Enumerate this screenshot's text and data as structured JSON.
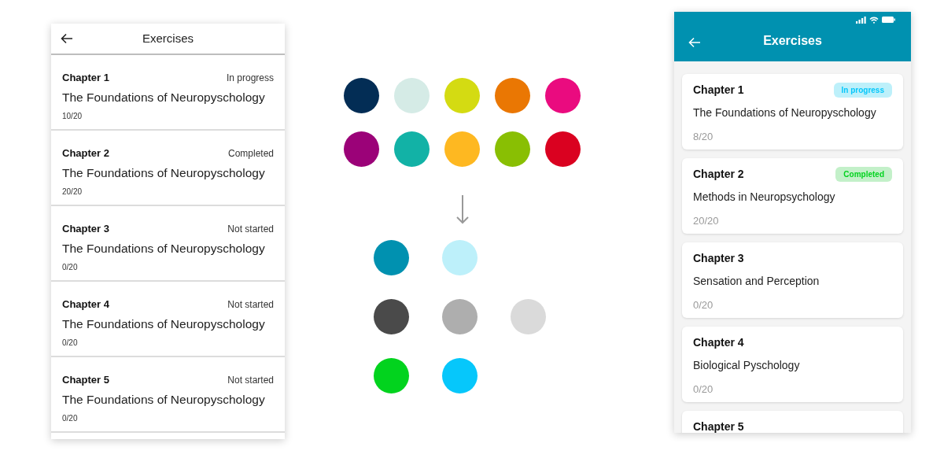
{
  "before_screen": {
    "title": "Exercises",
    "chapters": [
      {
        "chapter": "Chapter 1",
        "status": "In progress",
        "name": "The Foundations of Neuropyschology",
        "progress": "10/20"
      },
      {
        "chapter": "Chapter 2",
        "status": "Completed",
        "name": "The Foundations of Neuropyschology",
        "progress": "20/20"
      },
      {
        "chapter": "Chapter 3",
        "status": "Not started",
        "name": "The Foundations of Neuropyschology",
        "progress": "0/20"
      },
      {
        "chapter": "Chapter 4",
        "status": "Not started",
        "name": "The Foundations of Neuropyschology",
        "progress": "0/20"
      },
      {
        "chapter": "Chapter 5",
        "status": "Not started",
        "name": "The Foundations of Neuropyschology",
        "progress": "0/20"
      }
    ]
  },
  "palette": {
    "original_rows": [
      {
        "swatches": [
          {
            "color": "#032d55"
          },
          {
            "color": "#d5ebe6"
          },
          {
            "color": "#d4db12"
          },
          {
            "color": "#ea7703"
          },
          {
            "color": "#ea0b7f"
          }
        ]
      },
      {
        "swatches": [
          {
            "color": "#9b0278"
          },
          {
            "color": "#12b2a6"
          },
          {
            "color": "#feb821"
          },
          {
            "color": "#89bf03"
          },
          {
            "color": "#da0120"
          }
        ]
      }
    ],
    "new_rows": [
      {
        "swatches": [
          {
            "color": "#0091b0"
          },
          {
            "color": "#bdf0fa"
          }
        ]
      },
      {
        "swatches": [
          {
            "color": "#4a4a4a"
          },
          {
            "color": "#aeaeae"
          },
          {
            "color": "#dadada"
          }
        ]
      },
      {
        "swatches": [
          {
            "color": "#02d31e"
          },
          {
            "color": "#06c7fb"
          }
        ]
      }
    ]
  },
  "after_screen": {
    "title": "Exercises",
    "chapters": [
      {
        "chapter": "Chapter 1",
        "status": {
          "label": "In progress",
          "kind": "in_progress"
        },
        "name": "The Foundations of Neuropyschology",
        "progress": "8/20"
      },
      {
        "chapter": "Chapter 2",
        "status": {
          "label": "Completed",
          "kind": "completed"
        },
        "name": "Methods in Neuropsychology",
        "progress": "20/20"
      },
      {
        "chapter": "Chapter 3",
        "name": "Sensation and Perception",
        "progress": "0/20"
      },
      {
        "chapter": "Chapter 4",
        "name": "Biological Pyschology",
        "progress": "0/20"
      },
      {
        "chapter": "Chapter 5"
      }
    ]
  }
}
